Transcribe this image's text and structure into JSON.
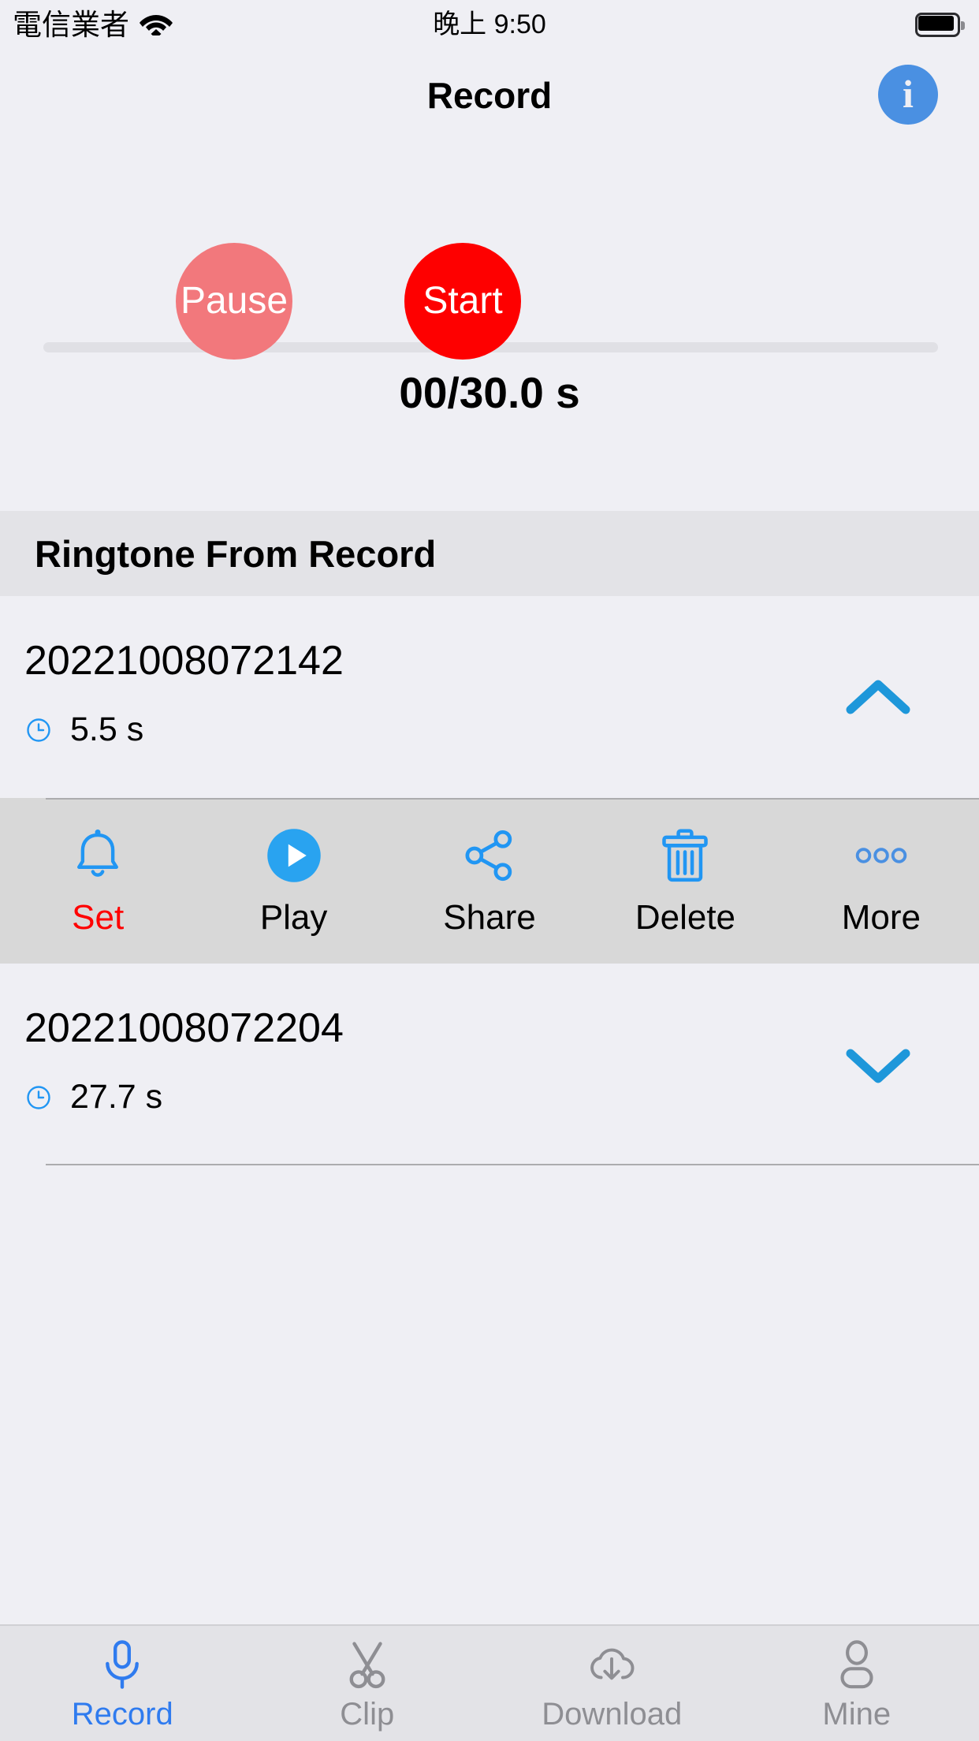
{
  "status_bar": {
    "carrier": "電信業者",
    "wifi_icon": "wifi-icon",
    "time": "晚上 9:50",
    "battery_icon": "battery-full-icon"
  },
  "nav": {
    "title": "Record",
    "info_button": {
      "name": "info-button",
      "glyph": "i",
      "color": "#4A90E2"
    }
  },
  "recorder": {
    "progress": {
      "value": 0,
      "max": 30.0,
      "percent": 0,
      "track_color": "#E0E0E5"
    },
    "timer_text": "00/30.0 s",
    "pause_button": {
      "label": "Pause",
      "color": "#F2787C"
    },
    "start_button": {
      "label": "Start",
      "color": "#FE0000"
    }
  },
  "section": {
    "header": "Ringtone From Record"
  },
  "list": {
    "items": [
      {
        "title": "20221008072142",
        "duration": "5.5 s",
        "clock_icon": "clock-icon",
        "chevron": "chevron-up-icon",
        "expanded": true
      },
      {
        "title": "20221008072204",
        "duration": "27.7 s",
        "clock_icon": "clock-icon",
        "chevron": "chevron-down-icon",
        "expanded": false
      }
    ]
  },
  "actions": [
    {
      "label": "Set",
      "icon": "bell-icon",
      "icon_color": "#2196F3",
      "label_color": "#FF0000"
    },
    {
      "label": "Play",
      "icon": "play-circle-icon",
      "icon_color": "#2196F3",
      "label_color": "#000000"
    },
    {
      "label": "Share",
      "icon": "share-icon",
      "icon_color": "#2196F3",
      "label_color": "#000000"
    },
    {
      "label": "Delete",
      "icon": "trash-icon",
      "icon_color": "#2196F3",
      "label_color": "#000000"
    },
    {
      "label": "More",
      "icon": "more-dots-icon",
      "icon_color": "#2196F3",
      "label_color": "#000000"
    }
  ],
  "tabs": [
    {
      "label": "Record",
      "icon": "microphone-icon",
      "active": true
    },
    {
      "label": "Clip",
      "icon": "scissors-icon",
      "active": false
    },
    {
      "label": "Download",
      "icon": "cloud-download-icon",
      "active": false
    },
    {
      "label": "Mine",
      "icon": "person-icon",
      "active": false
    }
  ],
  "colors": {
    "page_background": "#EFEFF4",
    "section_background": "#E3E3E7",
    "action_bar_background": "#D8D8D8",
    "accent_blue": "#2196F3",
    "tab_active": "#2F7BEF",
    "tab_inactive": "#8E8E93",
    "record_red": "#FE0000"
  }
}
